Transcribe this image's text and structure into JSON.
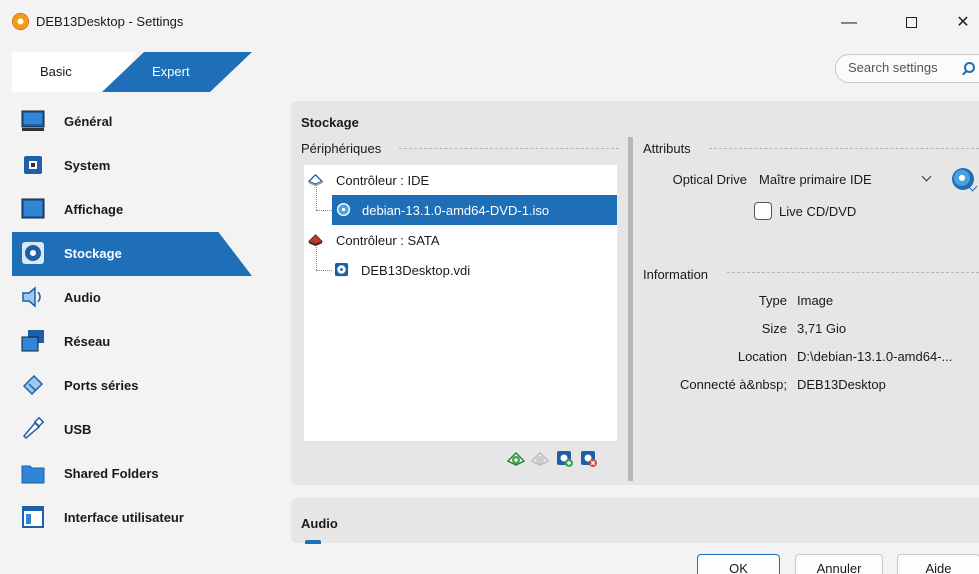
{
  "window": {
    "title": "DEB13Desktop - Settings",
    "minimize": "—",
    "close": "✕"
  },
  "mode_tabs": [
    {
      "label": "Basic",
      "selected": false
    },
    {
      "label": "Expert",
      "selected": true
    }
  ],
  "search": {
    "placeholder": "Search settings"
  },
  "sidebar": {
    "items": [
      {
        "label": "Général",
        "icon": "monitor-general-icon"
      },
      {
        "label": "System",
        "icon": "chip-icon"
      },
      {
        "label": "Affichage",
        "icon": "display-icon"
      },
      {
        "label": "Stockage",
        "icon": "storage-disc-icon",
        "active": true
      },
      {
        "label": "Audio",
        "icon": "speaker-icon"
      },
      {
        "label": "Réseau",
        "icon": "network-icon"
      },
      {
        "label": "Ports séries",
        "icon": "serial-port-icon"
      },
      {
        "label": "USB",
        "icon": "usb-icon"
      },
      {
        "label": "Shared Folders",
        "icon": "folder-icon"
      },
      {
        "label": "Interface utilisateur",
        "icon": "window-ui-icon"
      }
    ]
  },
  "storage": {
    "title": "Stockage",
    "devices_label": "Périphériques",
    "tree": [
      {
        "label": "Contrôleur : IDE",
        "type": "controller",
        "icon": "ide-controller-icon"
      },
      {
        "label": "debian-13.1.0-amd64-DVD-1.iso",
        "type": "optical",
        "icon": "optical-disc-icon",
        "selected": true
      },
      {
        "label": "Contrôleur : SATA",
        "type": "controller",
        "icon": "sata-controller-icon"
      },
      {
        "label": "DEB13Desktop.vdi",
        "type": "hdd",
        "icon": "hard-disk-icon"
      }
    ],
    "attributes": {
      "label": "Attributs",
      "optical_drive_label": "Optical Drive",
      "optical_drive_value": "Maître primaire IDE",
      "live_cd_label": "Live CD/DVD",
      "live_cd_checked": false
    },
    "information": {
      "label": "Information",
      "rows": [
        {
          "key": "Type",
          "value": "Image"
        },
        {
          "key": "Size",
          "value": "3,71 Gio"
        },
        {
          "key": "Location",
          "value": "D:\\debian-13.1.0-amd64-..."
        },
        {
          "key": "Connecté à&nbsp;",
          "value": "DEB13Desktop"
        }
      ]
    }
  },
  "audio": {
    "title": "Audio"
  },
  "buttons": {
    "ok": "OK",
    "cancel": "Annuler",
    "help": "Aide"
  },
  "colors": {
    "accent": "#1e6fb8",
    "panel": "#e6e6e6",
    "window": "#f3f3f3"
  }
}
